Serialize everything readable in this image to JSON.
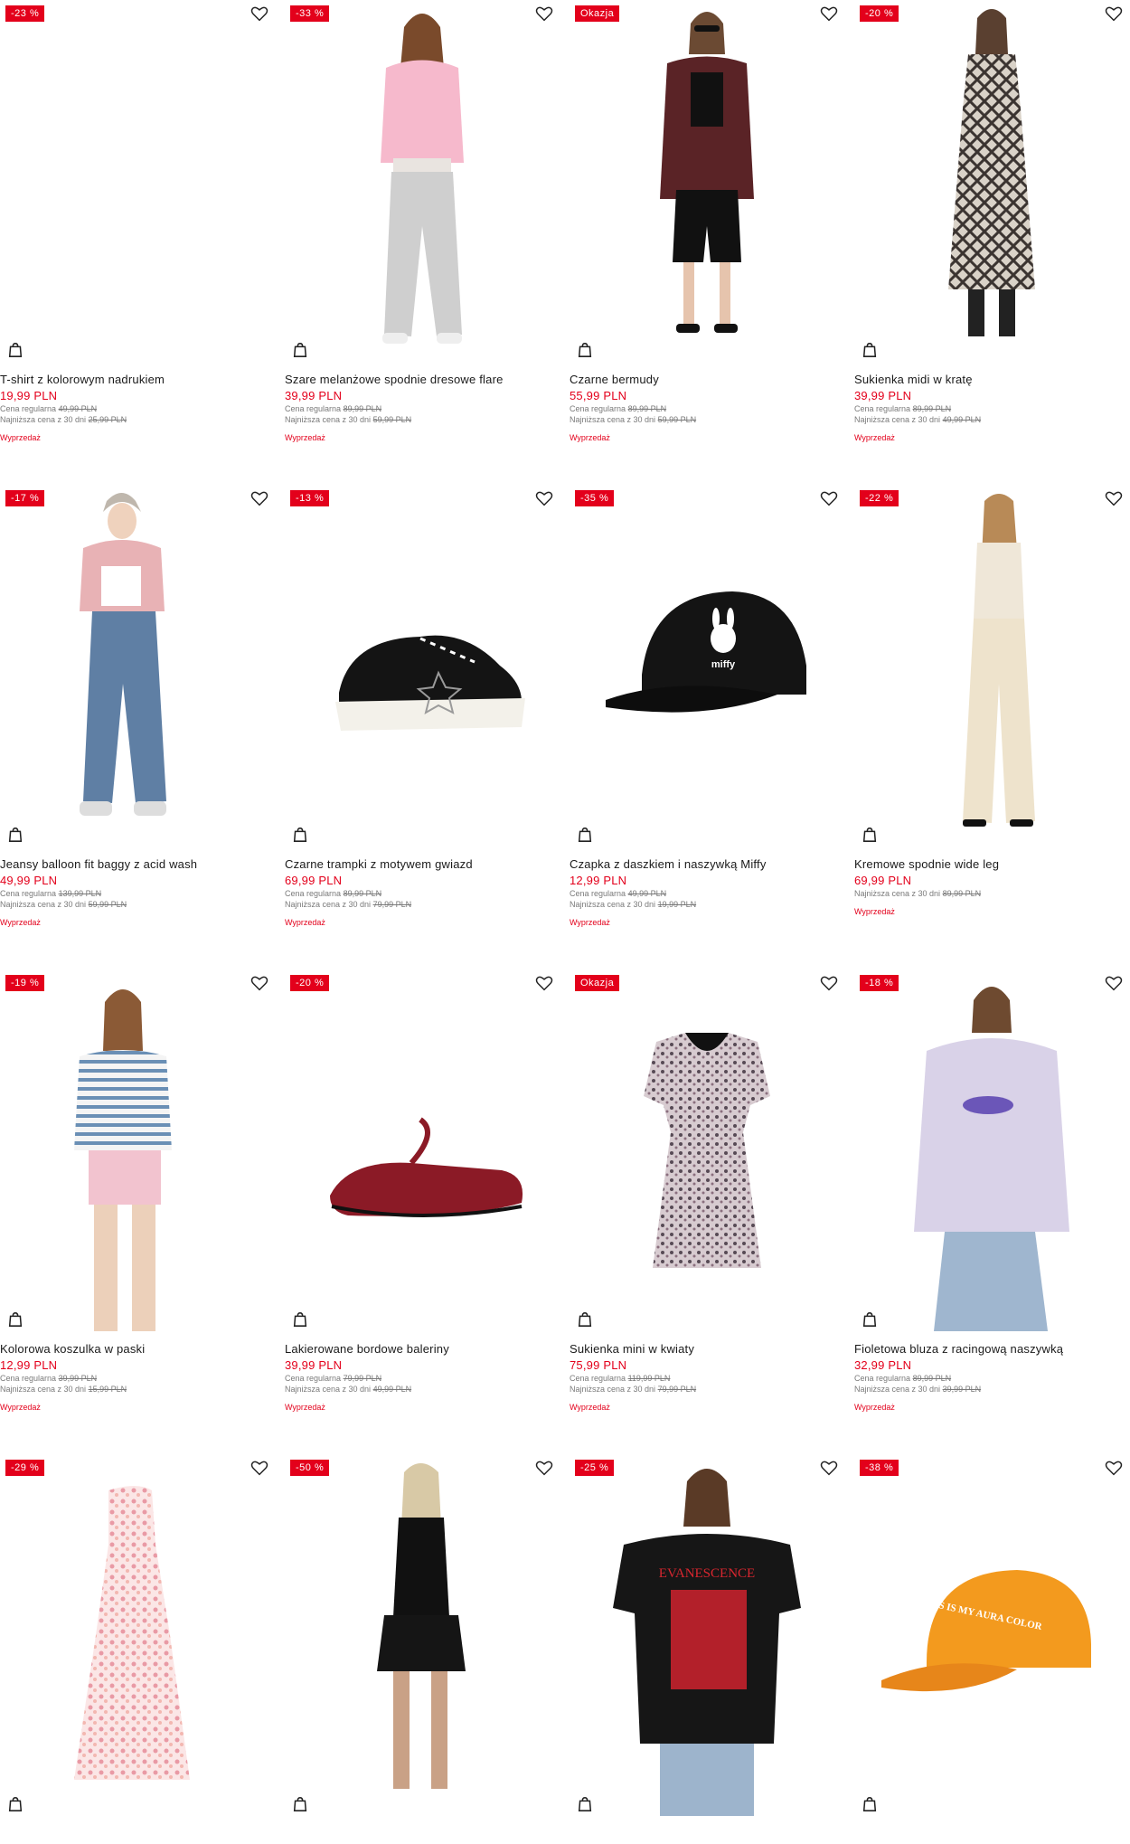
{
  "labels": {
    "regular_price": "Cena regularna",
    "lowest_price": "Najniższa cena z 30 dni",
    "sale": "Wyprzedaż"
  },
  "products": [
    {
      "badge": "-23 %",
      "title": "T-shirt z kolorowym nadrukiem",
      "price": "19,99 PLN",
      "regular": "49,99 PLN",
      "lowest": "25,99 PLN",
      "sale": "Wyprzedaż",
      "image": "blank"
    },
    {
      "badge": "-33 %",
      "title": "Szare melanżowe spodnie dresowe flare",
      "price": "39,99 PLN",
      "regular": "89,99 PLN",
      "lowest": "59,99 PLN",
      "sale": "Wyprzedaż",
      "image": "model-pink-hoodie"
    },
    {
      "badge": "Okazja",
      "title": "Czarne bermudy",
      "price": "55,99 PLN",
      "regular": "89,99 PLN",
      "lowest": "59,99 PLN",
      "sale": "Wyprzedaż",
      "image": "model-leather-jacket"
    },
    {
      "badge": "-20 %",
      "title": "Sukienka midi w kratę",
      "price": "39,99 PLN",
      "regular": "89,99 PLN",
      "lowest": "49,99 PLN",
      "sale": "Wyprzedaż",
      "image": "model-plaid-dress"
    },
    {
      "badge": "-17 %",
      "title": "Jeansy balloon fit baggy z acid wash",
      "price": "49,99 PLN",
      "regular": "139,99 PLN",
      "lowest": "59,99 PLN",
      "sale": "Wyprzedaż",
      "image": "model-jeans"
    },
    {
      "badge": "-13 %",
      "title": "Czarne trampki z motywem gwiazd",
      "price": "69,99 PLN",
      "regular": "89,99 PLN",
      "lowest": "79,99 PLN",
      "sale": "Wyprzedaż",
      "image": "sneaker"
    },
    {
      "badge": "-35 %",
      "title": "Czapka z daszkiem i naszywką Miffy",
      "price": "12,99 PLN",
      "regular": "49,99 PLN",
      "lowest": "19,99 PLN",
      "sale": "Wyprzedaż",
      "image": "black-cap"
    },
    {
      "badge": "-22 %",
      "title": "Kremowe spodnie wide leg",
      "price": "69,99 PLN",
      "regular": "",
      "lowest": "89,99 PLN",
      "sale": "Wyprzedaż",
      "image": "model-cream"
    },
    {
      "badge": "-19 %",
      "title": "Kolorowa koszulka w paski",
      "price": "12,99 PLN",
      "regular": "39,99 PLN",
      "lowest": "15,99 PLN",
      "sale": "Wyprzedaż",
      "image": "model-striped"
    },
    {
      "badge": "-20 %",
      "title": "Lakierowane bordowe baleriny",
      "price": "39,99 PLN",
      "regular": "79,99 PLN",
      "lowest": "49,99 PLN",
      "sale": "Wyprzedaż",
      "image": "ballerina"
    },
    {
      "badge": "Okazja",
      "title": "Sukienka mini w kwiaty",
      "price": "75,99 PLN",
      "regular": "119,99 PLN",
      "lowest": "79,99 PLN",
      "sale": "Wyprzedaż",
      "image": "floral-dress"
    },
    {
      "badge": "-18 %",
      "title": "Fioletowa bluza z racingową naszywką",
      "price": "32,99 PLN",
      "regular": "89,99 PLN",
      "lowest": "39,99 PLN",
      "sale": "Wyprzedaż",
      "image": "model-lilac-hoodie"
    },
    {
      "badge": "-29 %",
      "title": "",
      "price": "",
      "regular": "",
      "lowest": "",
      "sale": "",
      "image": "halter-dress"
    },
    {
      "badge": "-50 %",
      "title": "",
      "price": "",
      "regular": "",
      "lowest": "",
      "sale": "",
      "image": "model-black-dress"
    },
    {
      "badge": "-25 %",
      "title": "",
      "price": "",
      "regular": "",
      "lowest": "",
      "sale": "",
      "image": "model-evanescence"
    },
    {
      "badge": "-38 %",
      "title": "",
      "price": "",
      "regular": "",
      "lowest": "",
      "sale": "",
      "image": "orange-cap"
    }
  ],
  "image_text": {
    "cap_logo": "miffy",
    "tshirt_print": "EVANESCENCE",
    "orange_cap_print": "THIS IS MY AURA COLOR"
  },
  "colors": {
    "accent_red": "#e3001b",
    "text_dark": "#1a1a1a",
    "text_muted": "#7a7a7a"
  }
}
